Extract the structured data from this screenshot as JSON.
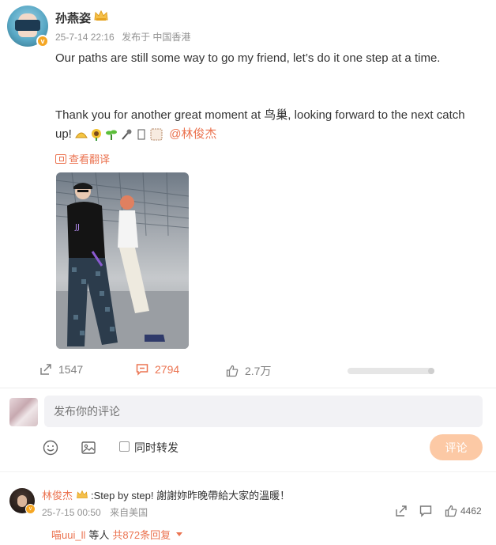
{
  "post": {
    "author": "孙燕姿",
    "timestamp": "25-7-14 22:16",
    "location": "发布于 中国香港",
    "line1": "Our paths are still some way to go my friend, let’s do it one step at a time.",
    "line2": "Thank you for another great moment at 鸟巢, looking forward to the next catch up!",
    "mention": "@林俊杰",
    "translate_label": "查看翻译",
    "emojis": [
      "taco-emoji",
      "sunflower-emoji",
      "sprout-emoji",
      "microphone-emoji",
      "placeholder-box",
      "frame-emoji"
    ]
  },
  "actions": {
    "share_count": "1547",
    "comment_count": "2794",
    "like_count": "2.7万"
  },
  "composer": {
    "placeholder": "发布你的评论",
    "repost_label": "同时转发",
    "submit_label": "评论"
  },
  "comment": {
    "author": "林俊杰",
    "text": ":Step by step! 謝謝妳昨晚帶給大家的溫暖！",
    "timestamp": "25-7-15 00:50",
    "location": "来自美国",
    "like_count": "4462",
    "replies_who": "喵uui_ll",
    "replies_mid": "等人",
    "replies_count": "共872条回复"
  },
  "colors": {
    "accent": "#eb7350",
    "vip": "#f5a623",
    "submit_disabled": "#fcc9a5"
  }
}
